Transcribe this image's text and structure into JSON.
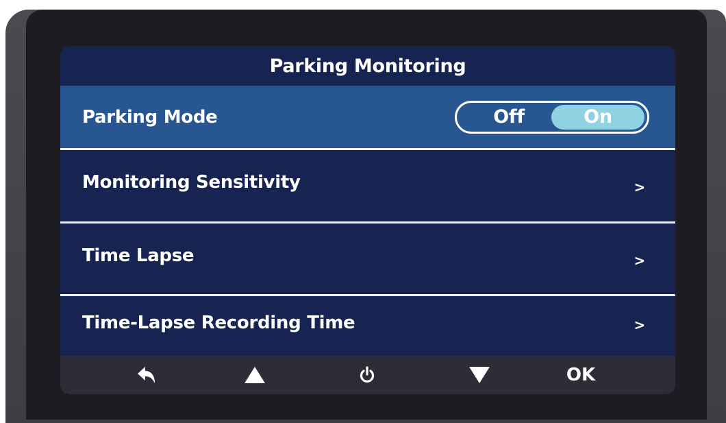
{
  "screen": {
    "title": "Parking Monitoring"
  },
  "menu": {
    "items": [
      {
        "label": "Parking Mode",
        "type": "toggle",
        "selected": true
      },
      {
        "label": "Monitoring Sensitivity",
        "type": "submenu",
        "chevron": ">"
      },
      {
        "label": "Time Lapse",
        "type": "submenu",
        "chevron": ">"
      },
      {
        "label": "Time-Lapse Recording Time",
        "type": "submenu",
        "chevron": ">"
      }
    ]
  },
  "toggle": {
    "off_label": "Off",
    "on_label": "On",
    "value": "On"
  },
  "bottom_bar": {
    "buttons": [
      {
        "icon": "back-icon"
      },
      {
        "icon": "up-arrow-icon"
      },
      {
        "icon": "power-icon"
      },
      {
        "icon": "down-arrow-icon"
      },
      {
        "label": "OK"
      }
    ]
  },
  "colors": {
    "background": "#172350",
    "selected_row": "#275691",
    "toggle_on": "#8fd3e3",
    "bottom_bar": "#2c2d36",
    "text": "#ffffff"
  }
}
